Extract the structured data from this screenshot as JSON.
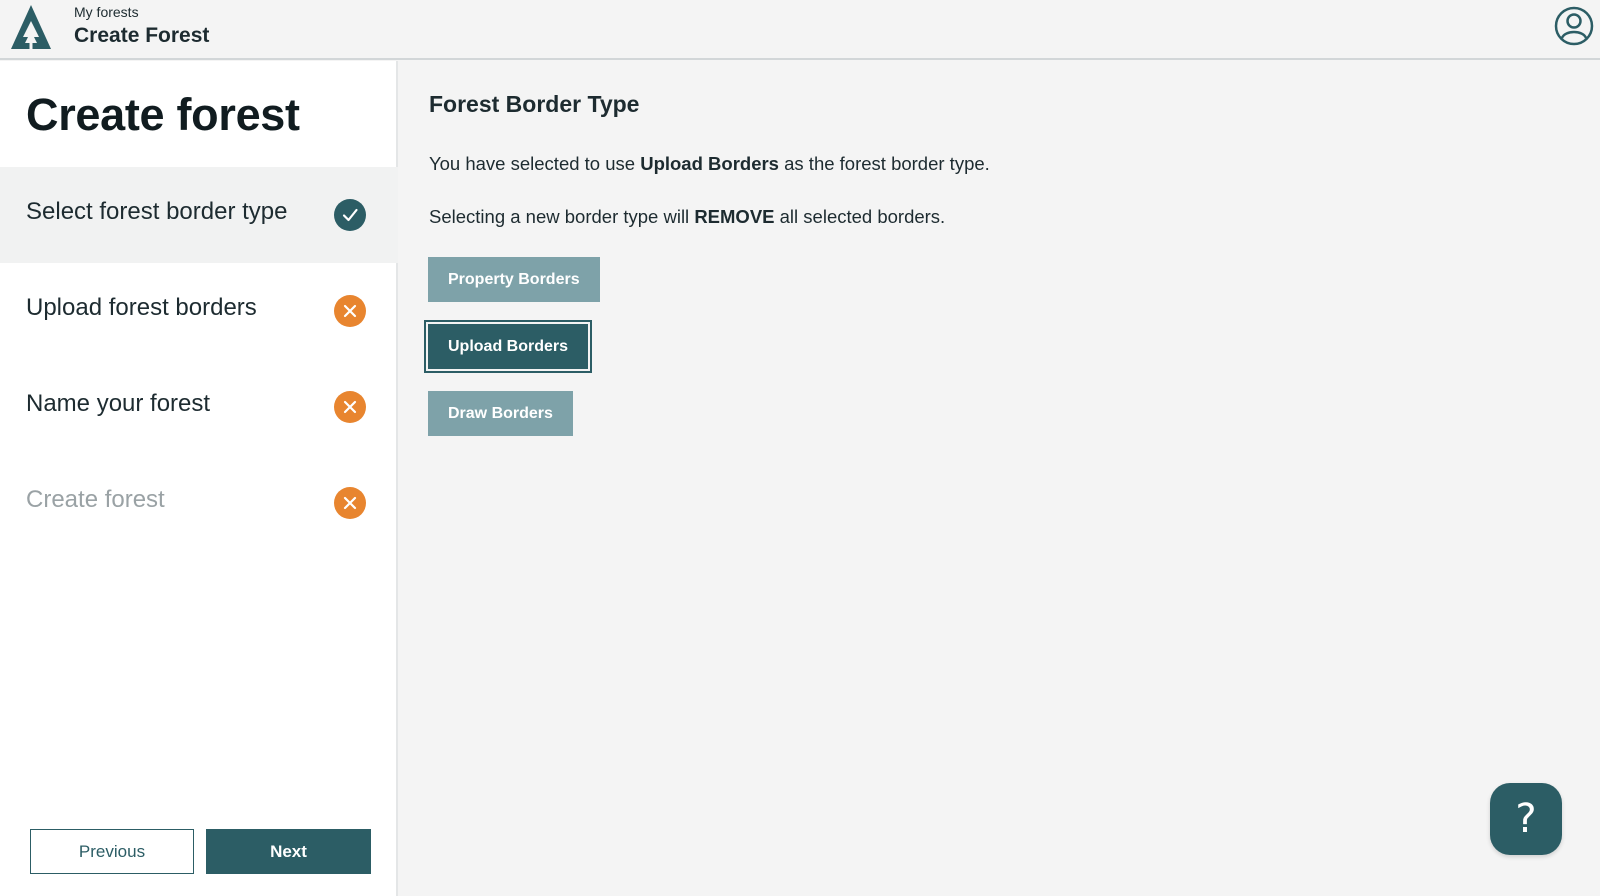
{
  "header": {
    "breadcrumb": "My forests",
    "title": "Create Forest",
    "logo_icon": "tree-logo-icon",
    "account_icon": "user-account-icon"
  },
  "sidebar": {
    "title": "Create forest",
    "steps": [
      {
        "label": "Select forest border type",
        "status": "complete",
        "active": true
      },
      {
        "label": "Upload forest borders",
        "status": "incomplete",
        "active": false
      },
      {
        "label": "Name your forest",
        "status": "incomplete",
        "active": false
      },
      {
        "label": "Create forest",
        "status": "incomplete",
        "active": false,
        "disabled": true
      }
    ],
    "previous_label": "Previous",
    "next_label": "Next"
  },
  "main": {
    "heading": "Forest Border Type",
    "selected_text": {
      "before": "You have selected to use ",
      "bold": "Upload Borders",
      "after": " as the forest border type."
    },
    "warning_text": {
      "before": "Selecting a new border type will ",
      "bold": "REMOVE",
      "after": " all selected borders."
    },
    "border_types": [
      {
        "label": "Property Borders",
        "selected": false
      },
      {
        "label": "Upload Borders",
        "selected": true
      },
      {
        "label": "Draw Borders",
        "selected": false
      }
    ]
  },
  "help": {
    "icon": "question-mark-icon",
    "label": "?"
  },
  "colors": {
    "primary": "#2c5d65",
    "primary_light": "#7ea2a9",
    "warning": "#e8852f",
    "background": "#f4f4f4"
  }
}
